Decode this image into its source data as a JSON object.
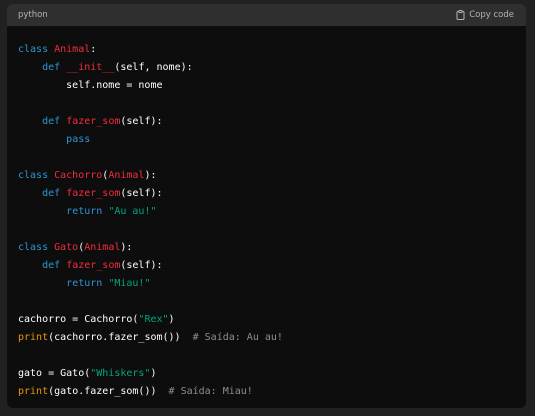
{
  "header": {
    "language": "python",
    "copy_label": "Copy code"
  },
  "code": {
    "lines": [
      [
        {
          "t": "class ",
          "c": "kw"
        },
        {
          "t": "Animal",
          "c": "fn"
        },
        {
          "t": ":",
          "c": ""
        }
      ],
      [
        {
          "t": "    ",
          "c": ""
        },
        {
          "t": "def ",
          "c": "kw"
        },
        {
          "t": "__init__",
          "c": "fn"
        },
        {
          "t": "(self, nome):",
          "c": ""
        }
      ],
      [
        {
          "t": "        self.nome = nome",
          "c": ""
        }
      ],
      [],
      [
        {
          "t": "    ",
          "c": ""
        },
        {
          "t": "def ",
          "c": "kw"
        },
        {
          "t": "fazer_som",
          "c": "fn"
        },
        {
          "t": "(self):",
          "c": ""
        }
      ],
      [
        {
          "t": "        ",
          "c": ""
        },
        {
          "t": "pass",
          "c": "kw"
        }
      ],
      [],
      [
        {
          "t": "class ",
          "c": "kw"
        },
        {
          "t": "Cachorro",
          "c": "fn"
        },
        {
          "t": "(",
          "c": ""
        },
        {
          "t": "Animal",
          "c": "fn"
        },
        {
          "t": "):",
          "c": ""
        }
      ],
      [
        {
          "t": "    ",
          "c": ""
        },
        {
          "t": "def ",
          "c": "kw"
        },
        {
          "t": "fazer_som",
          "c": "fn"
        },
        {
          "t": "(self):",
          "c": ""
        }
      ],
      [
        {
          "t": "        ",
          "c": ""
        },
        {
          "t": "return ",
          "c": "kw"
        },
        {
          "t": "\"Au au!\"",
          "c": "str"
        }
      ],
      [],
      [
        {
          "t": "class ",
          "c": "kw"
        },
        {
          "t": "Gato",
          "c": "fn"
        },
        {
          "t": "(",
          "c": ""
        },
        {
          "t": "Animal",
          "c": "fn"
        },
        {
          "t": "):",
          "c": ""
        }
      ],
      [
        {
          "t": "    ",
          "c": ""
        },
        {
          "t": "def ",
          "c": "kw"
        },
        {
          "t": "fazer_som",
          "c": "fn"
        },
        {
          "t": "(self):",
          "c": ""
        }
      ],
      [
        {
          "t": "        ",
          "c": ""
        },
        {
          "t": "return ",
          "c": "kw"
        },
        {
          "t": "\"Miau!\"",
          "c": "str"
        }
      ],
      [],
      [
        {
          "t": "cachorro = Cachorro(",
          "c": ""
        },
        {
          "t": "\"Rex\"",
          "c": "str"
        },
        {
          "t": ")",
          "c": ""
        }
      ],
      [
        {
          "t": "print",
          "c": "print"
        },
        {
          "t": "(cachorro.fazer_som())  ",
          "c": ""
        },
        {
          "t": "# Saída: Au au!",
          "c": "cm"
        }
      ],
      [],
      [
        {
          "t": "gato = Gato(",
          "c": ""
        },
        {
          "t": "\"Whiskers\"",
          "c": "str"
        },
        {
          "t": ")",
          "c": ""
        }
      ],
      [
        {
          "t": "print",
          "c": "print"
        },
        {
          "t": "(gato.fazer_som())  ",
          "c": ""
        },
        {
          "t": "# Saída: Miau!",
          "c": "cm"
        }
      ]
    ]
  },
  "colors": {
    "keyword": "#2e95d3",
    "name": "#f22c3d",
    "string": "#00a67d",
    "builtin": "#e9950c",
    "comment": "#8e8e8e"
  },
  "icons": {
    "copy": "clipboard-icon"
  }
}
